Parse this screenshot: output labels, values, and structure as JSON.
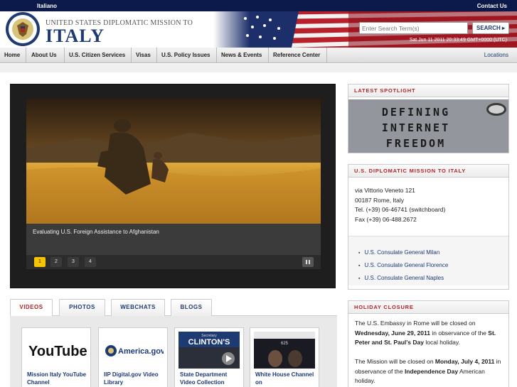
{
  "topbar": {
    "language": "Italiano",
    "contact": "Contact Us"
  },
  "header": {
    "mission_line": "UNITED STATES DIPLOMATIC MISSION TO",
    "country": "ITALY",
    "search_placeholder": "Enter Search Term(s)",
    "search_button": "SEARCH",
    "datetime": "Sat Jun 11 2011 20:33:49 GMT+0000 (UTC)"
  },
  "nav": {
    "items": [
      "Home",
      "About Us",
      "U.S. Citizen Services",
      "Visas",
      "U.S. Policy Issues",
      "News & Events",
      "Reference Center"
    ],
    "locations": "Locations"
  },
  "slideshow": {
    "caption": "Evaluating U.S. Foreign Assistance to Afghanistan",
    "pages": [
      "1",
      "2",
      "3",
      "4"
    ],
    "active_page": "1"
  },
  "tabs": {
    "items": [
      "VIDEOS",
      "PHOTOS",
      "WEBCHATS",
      "BLOGS"
    ],
    "active": "VIDEOS",
    "cards": [
      {
        "title": "Mission Italy YouTube Channel",
        "thumb_text": "YouTube"
      },
      {
        "title": "IIP Digital.gov Video Library",
        "thumb_text": "America.gov"
      },
      {
        "title": "State Department Video Collection",
        "thumb_text": "CLINTON'S",
        "thumb_subtext": "Secretary"
      },
      {
        "title": "White House Channel on",
        "thumb_text": "625"
      }
    ]
  },
  "spotlight": {
    "title": "LATEST SPOTLIGHT",
    "lines": [
      "DEFINING",
      "INTERNET",
      "FREEDOM"
    ]
  },
  "mission": {
    "title": "U.S. DIPLOMATIC MISSION TO ITALY",
    "address": [
      "via Vittorio Veneto 121",
      "00187 Rome, Italy",
      "Tel. (+39) 06-46741 (switchboard)",
      "Fax (+39) 06-488.2672"
    ],
    "links": [
      "U.S. Consulate General Milan",
      "U.S. Consulate General Florence",
      "U.S. Consulate General Naples"
    ]
  },
  "holiday": {
    "title": "HOLIDAY CLOSURE",
    "p1_a": "The U.S. Embassy in Rome will be closed on ",
    "p1_b": "Wednesday, June 29, 2011",
    "p1_c": " in observance of the ",
    "p1_d": "St. Peter and St. Paul's Day",
    "p1_e": " local holiday.",
    "p2_a": "The Mission will be closed on ",
    "p2_b": "Monday, July 4, 2011",
    "p2_c": " in observance of the ",
    "p2_d": "Independence Day",
    "p2_e": " American holiday."
  },
  "colors": {
    "navy": "#0b1a4a",
    "accent_red": "#b22222",
    "link_blue": "#1d3a73",
    "active_page": "#f6c400"
  }
}
